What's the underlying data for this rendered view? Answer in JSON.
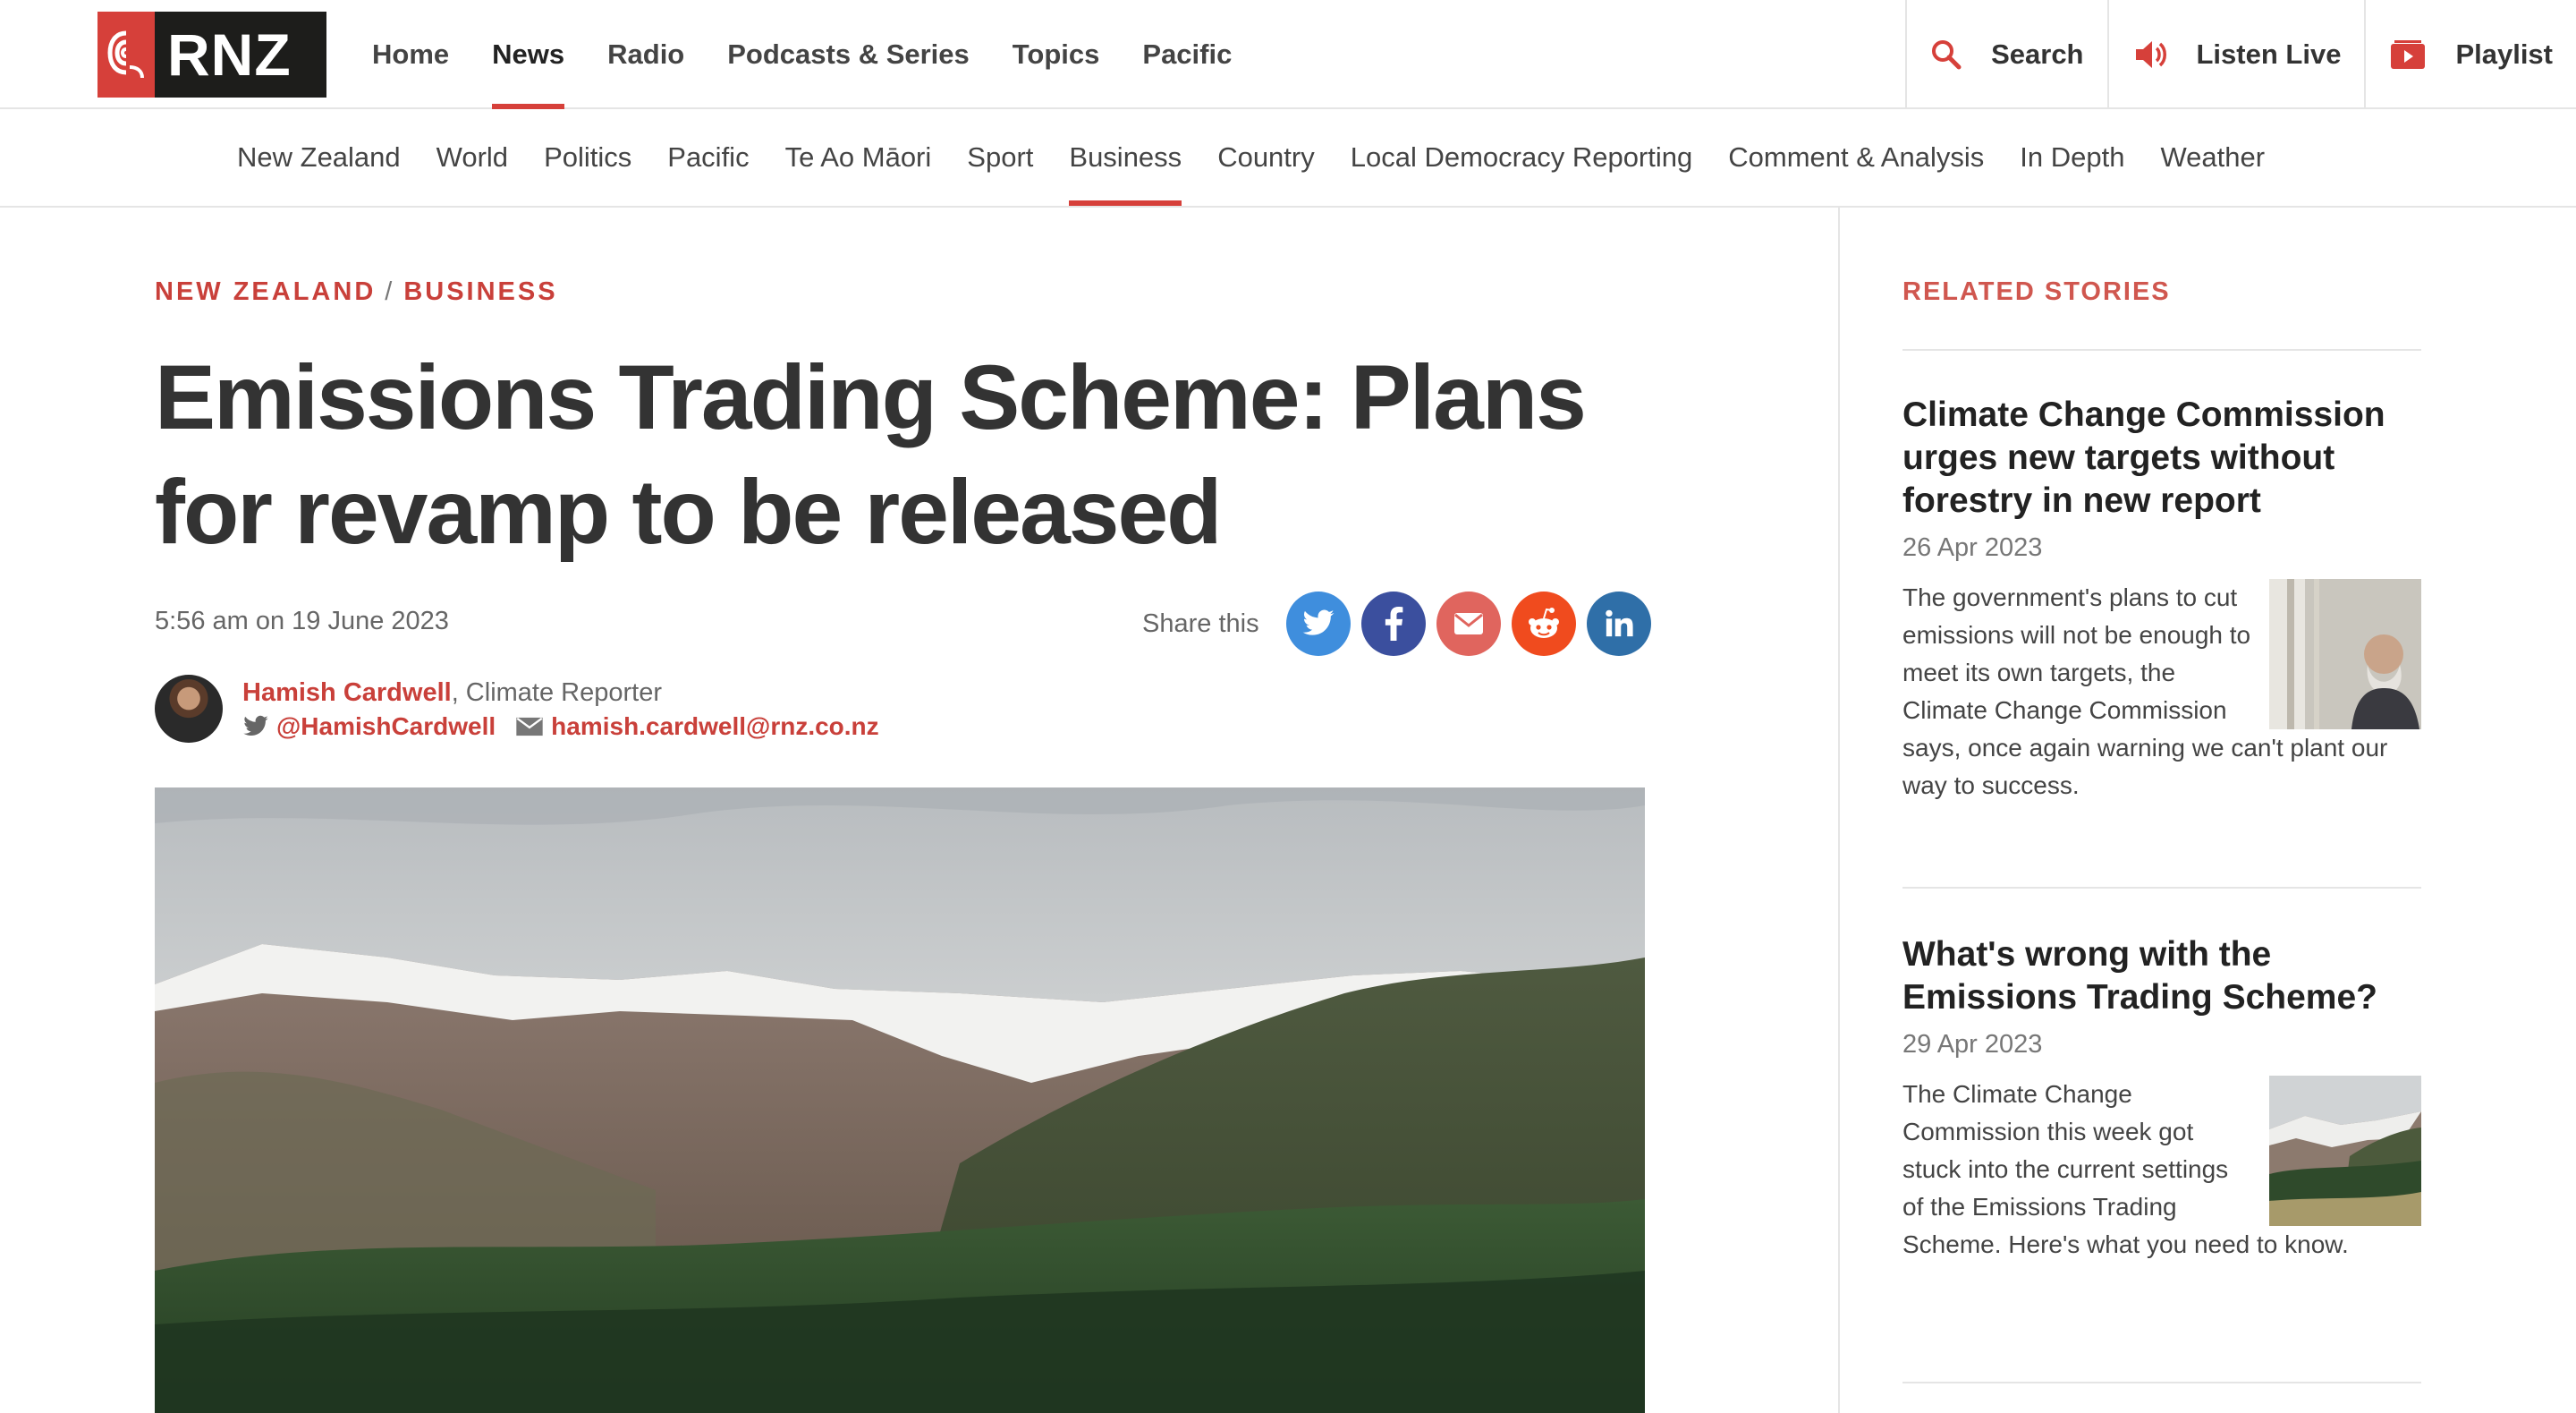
{
  "brand": {
    "logo_text": "RNZ",
    "accent": "#d6403a"
  },
  "main_nav": {
    "items": [
      {
        "label": "Home"
      },
      {
        "label": "News",
        "active": true
      },
      {
        "label": "Radio"
      },
      {
        "label": "Podcasts & Series"
      },
      {
        "label": "Topics"
      },
      {
        "label": "Pacific"
      }
    ]
  },
  "utility_nav": {
    "search": {
      "label": "Search",
      "icon": "search-icon"
    },
    "listen": {
      "label": "Listen Live",
      "icon": "speaker-icon"
    },
    "playlist": {
      "label": "Playlist",
      "icon": "playlist-icon"
    }
  },
  "sub_nav": {
    "items": [
      {
        "label": "New Zealand"
      },
      {
        "label": "World"
      },
      {
        "label": "Politics"
      },
      {
        "label": "Pacific"
      },
      {
        "label": "Te Ao Māori"
      },
      {
        "label": "Sport"
      },
      {
        "label": "Business",
        "active": true
      },
      {
        "label": "Country"
      },
      {
        "label": "Local Democracy Reporting"
      },
      {
        "label": "Comment & Analysis"
      },
      {
        "label": "In Depth"
      },
      {
        "label": "Weather"
      }
    ]
  },
  "article": {
    "kicker": {
      "primary": "NEW ZEALAND",
      "separator": "/",
      "secondary": "BUSINESS"
    },
    "headline": "Emissions Trading Scheme: Plans for revamp to be released",
    "dateline": "5:56 am on 19 June 2023",
    "share": {
      "label": "Share this",
      "buttons": [
        {
          "name": "twitter",
          "icon": "twitter-icon",
          "color": "#3f8edd"
        },
        {
          "name": "facebook",
          "icon": "facebook-icon",
          "color": "#3b4f9e"
        },
        {
          "name": "email",
          "icon": "mail-icon",
          "color": "#e0655e"
        },
        {
          "name": "reddit",
          "icon": "reddit-icon",
          "color": "#f04b1e"
        },
        {
          "name": "linkedin",
          "icon": "linkedin-icon",
          "color": "#2f6fa8"
        }
      ]
    },
    "author": {
      "name": "Hamish Cardwell",
      "role": ", Climate Reporter",
      "twitter": "@HamishCardwell",
      "email": "hamish.cardwell@rnz.co.nz"
    }
  },
  "related": {
    "title": "RELATED STORIES",
    "stories": [
      {
        "title": "Climate Change Commission urges new targets without forestry in new report",
        "date": "26 Apr 2023",
        "summary": "The government's plans to cut emissions will not be enough to meet its own targets, the Climate Change Commission says, once again warning we can't plant our way to success."
      },
      {
        "title": "What's wrong with the Emissions Trading Scheme?",
        "date": "29 Apr 2023",
        "summary": "The Climate Change Commission this week got stuck into the current settings of the Emissions Trading Scheme. Here's what you need to know."
      }
    ]
  }
}
